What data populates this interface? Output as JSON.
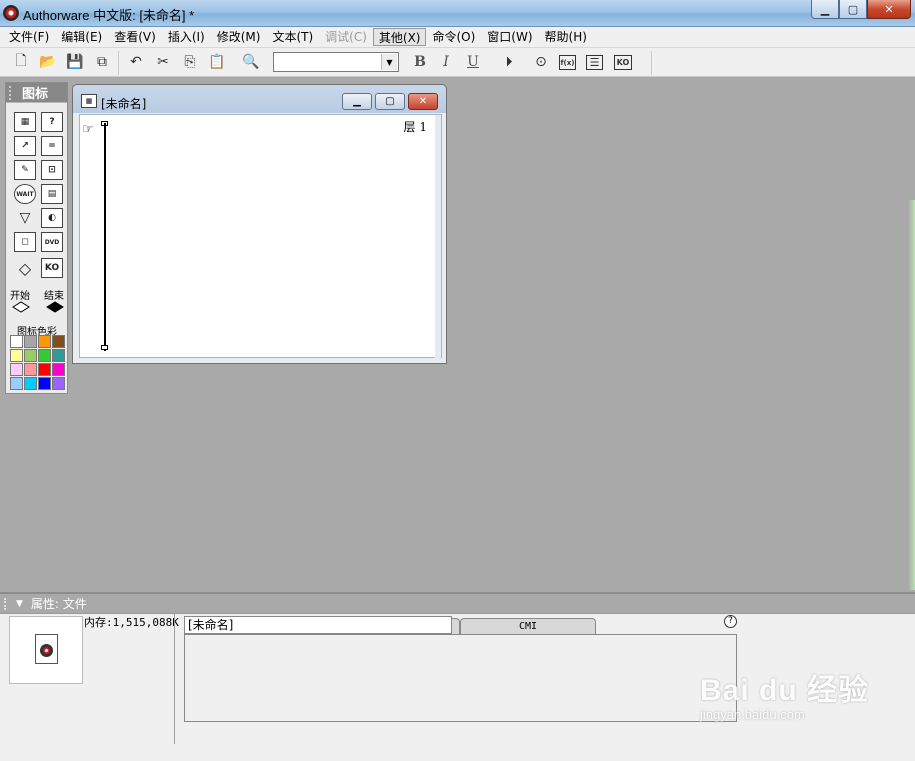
{
  "window": {
    "title": "Authorware 中文版: [未命名] *",
    "minimize": "▁",
    "maximize": "▢",
    "close": "✕"
  },
  "menu": [
    {
      "label": "文件(F)",
      "state": "normal"
    },
    {
      "label": "编辑(E)",
      "state": "normal"
    },
    {
      "label": "查看(V)",
      "state": "normal"
    },
    {
      "label": "插入(I)",
      "state": "normal"
    },
    {
      "label": "修改(M)",
      "state": "normal"
    },
    {
      "label": "文本(T)",
      "state": "normal"
    },
    {
      "label": "调试(C)",
      "state": "disabled"
    },
    {
      "label": "其他(X)",
      "state": "active"
    },
    {
      "label": "命令(O)",
      "state": "normal"
    },
    {
      "label": "窗口(W)",
      "state": "normal"
    },
    {
      "label": "帮助(H)",
      "state": "normal"
    }
  ],
  "toolbar": {
    "font_combo_value": "",
    "bold": "B",
    "italic": "I",
    "underline": "U",
    "func_label": "f(x)",
    "ko_label": "KO"
  },
  "palette": {
    "title": "图标",
    "start_label": "开始",
    "end_label": "结束",
    "colors_label": "图标色彩",
    "wait_label": "WAIT",
    "dvd_label": "DVD",
    "ko_label": "KO",
    "colors": [
      "#ffffff",
      "#a6a6a6",
      "#ff9900",
      "#7f4f1f",
      "#ffff99",
      "#99cc66",
      "#33cc33",
      "#339999",
      "#ffccff",
      "#ff9999",
      "#ff0000",
      "#ff00cc",
      "#99ccff",
      "#00ccff",
      "#0000ff",
      "#9966ff"
    ]
  },
  "design_window": {
    "title": "[未命名]",
    "layer": "层 1"
  },
  "properties": {
    "header": "属性: 文件",
    "memory": "内存:1,515,088K",
    "file_name": "[未命名]",
    "tab_cmi": "CMI",
    "help": "?"
  },
  "watermark": {
    "main": "Bai du 经验",
    "sub": "jingyan.baidu.com"
  }
}
